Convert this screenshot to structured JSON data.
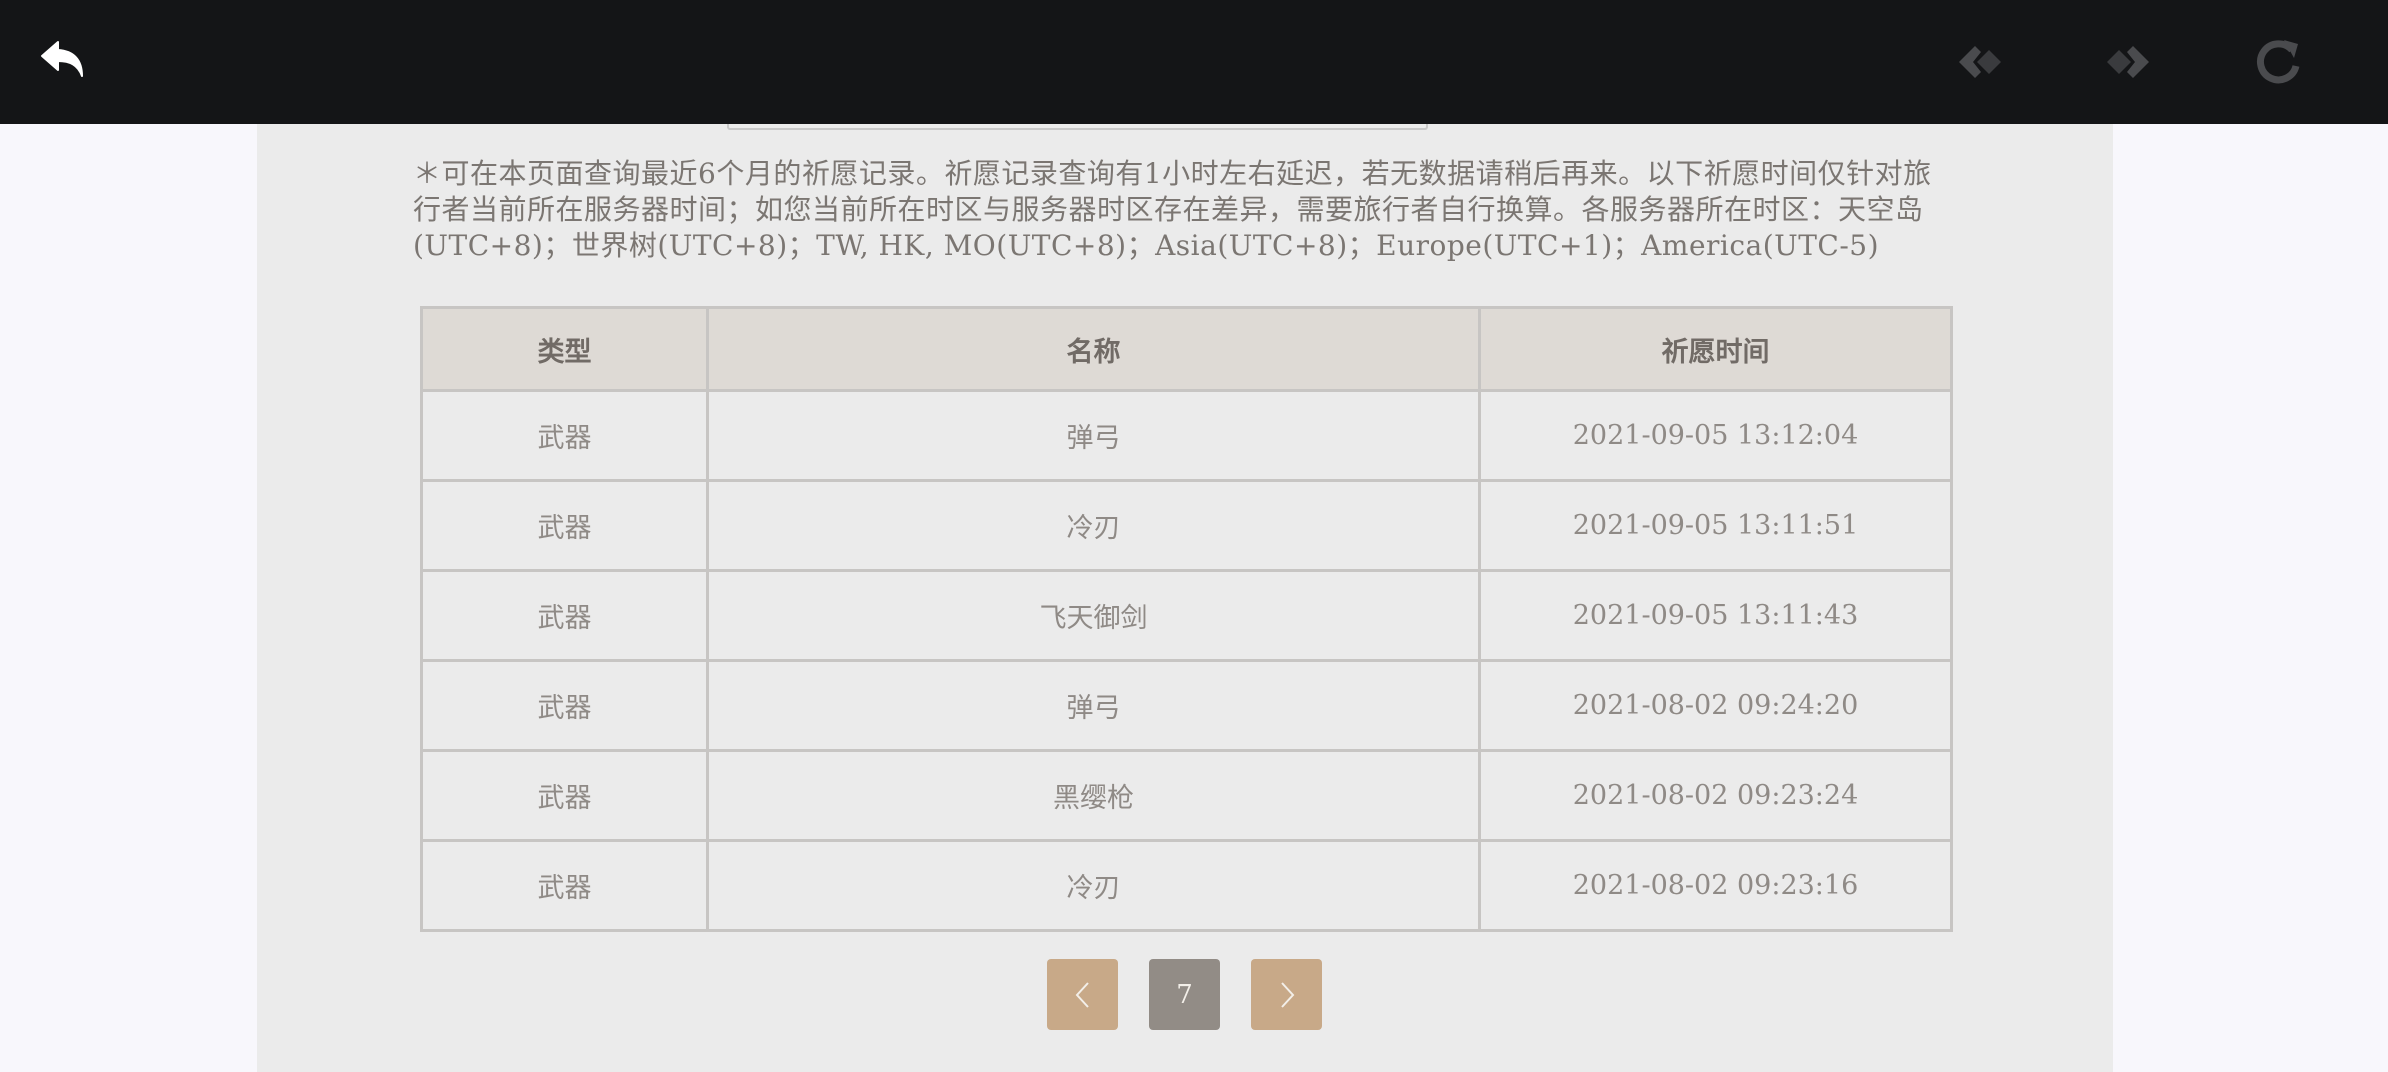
{
  "toolbar": {
    "back_icon": "back-arrow-icon",
    "prev_icon": "nav-back-icon",
    "forward_icon": "nav-forward-icon",
    "refresh_icon": "refresh-icon",
    "background": "#141517"
  },
  "notice": {
    "text": "＊可在本页面查询最近6个月的祈愿记录。祈愿记录查询有1小时左右延迟，若无数据请稍后再来。以下祈愿时间仅针对旅行者当前所在服务器时间；如您当前所在时区与服务器时区存在差异，需要旅行者自行换算。各服务器所在时区：天空岛(UTC+8)；世界树(UTC+8)；TW, HK, MO(UTC+8)；Asia(UTC+8)；Europe(UTC+1)；America(UTC-5)"
  },
  "table": {
    "headers": [
      "类型",
      "名称",
      "祈愿时间"
    ],
    "rows": [
      [
        "武器",
        "弹弓",
        "2021-09-05 13:12:04"
      ],
      [
        "武器",
        "冷刃",
        "2021-09-05 13:11:51"
      ],
      [
        "武器",
        "飞天御剑",
        "2021-09-05 13:11:43"
      ],
      [
        "武器",
        "弹弓",
        "2021-08-02 09:24:20"
      ],
      [
        "武器",
        "黑缨枪",
        "2021-08-02 09:23:24"
      ],
      [
        "武器",
        "冷刃",
        "2021-08-02 09:23:16"
      ]
    ]
  },
  "pagination": {
    "prev_icon": "chevron-left-icon",
    "current_page": "7",
    "next_icon": "chevron-right-icon",
    "accent_color": "#c8a988",
    "current_color": "#928c86"
  }
}
